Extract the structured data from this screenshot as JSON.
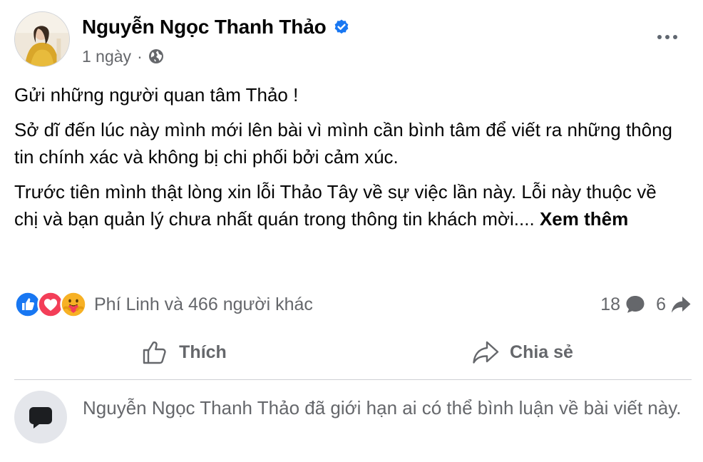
{
  "post": {
    "author_name": "Nguyễn Ngọc Thanh Thảo",
    "time": "1 ngày",
    "separator": "·",
    "paragraphs": [
      "Gửi những người quan tâm Thảo !",
      "Sở dĩ đến lúc này mình mới lên bài vì mình cần bình tâm để viết ra những thông tin chính xác và không bị chi phối bởi cảm xúc.",
      "Trước tiên mình thật lòng xin lỗi Thảo Tây về sự việc lần này. Lỗi này thuộc về chị và bạn quản lý chưa nhất quán trong thông tin khách mời...."
    ],
    "see_more": "Xem thêm"
  },
  "reactions": {
    "icons": [
      "like-reaction-icon",
      "love-reaction-icon",
      "care-reaction-icon"
    ],
    "text": "Phí Linh và 466 người khác",
    "comments_count": "18",
    "shares_count": "6"
  },
  "actions": {
    "like_label": "Thích",
    "share_label": "Chia sẻ"
  },
  "notice": {
    "text": "Nguyễn Ngọc Thanh Thảo đã giới hạn ai có thể bình luận về bài viết này."
  },
  "colors": {
    "verified_blue": "#1877f2",
    "secondary_text": "#65676b",
    "like_blue": "#1877f2",
    "love_red": "#f33e58",
    "care_yellow": "#f7b125",
    "divider": "#ced0d4"
  }
}
